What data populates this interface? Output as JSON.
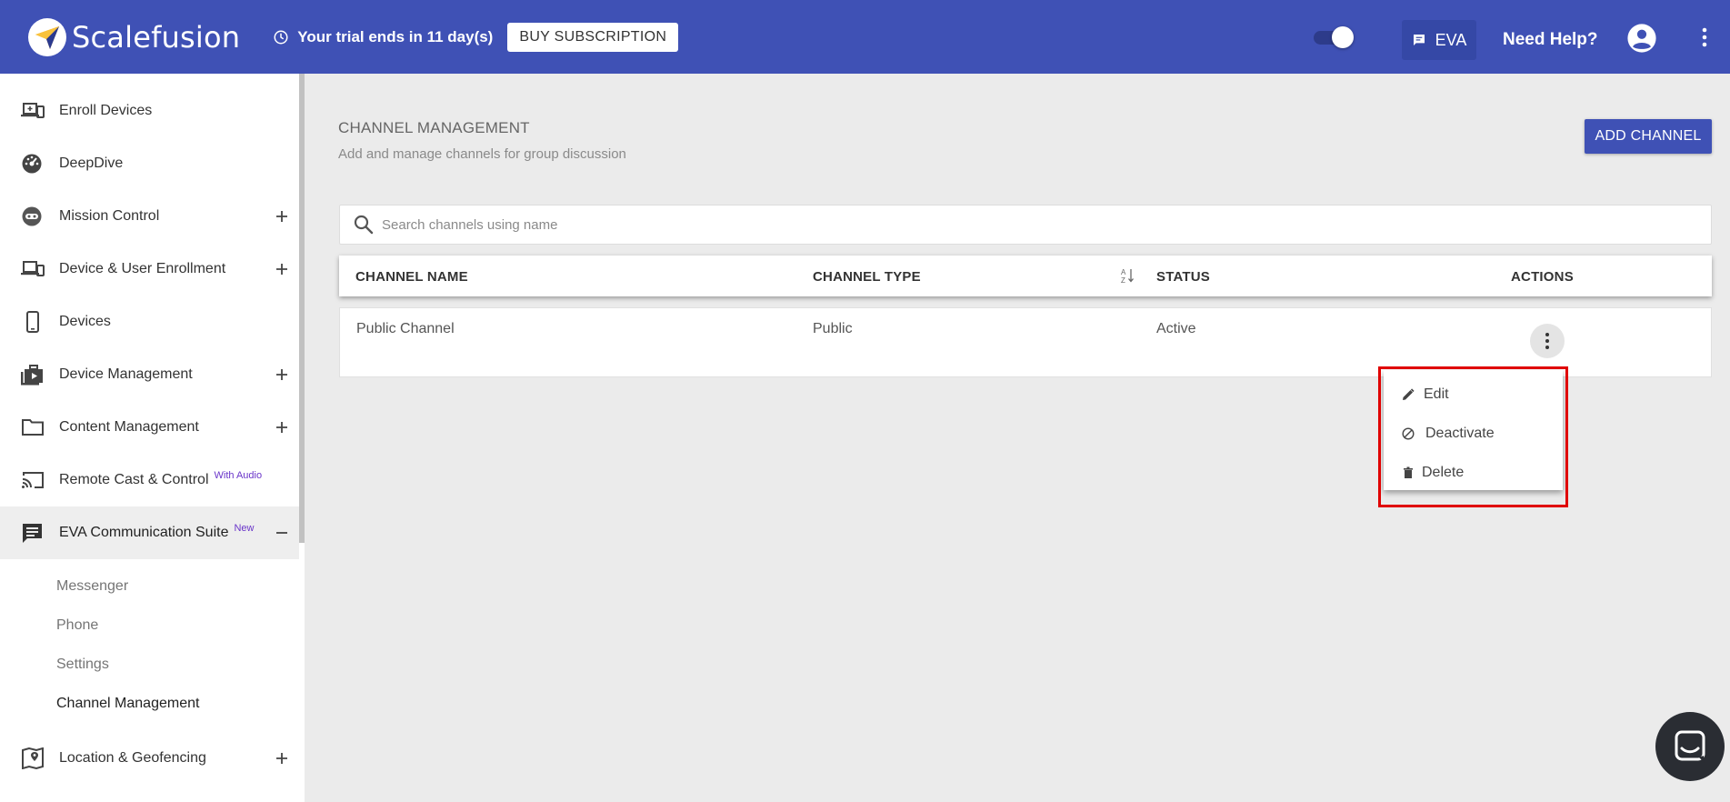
{
  "header": {
    "brand": "Scalefusion",
    "trial_text": "Your trial ends in 11 day(s)",
    "buy_label": "BUY SUBSCRIPTION",
    "eva_label": "EVA",
    "help_label": "Need Help?",
    "toggle_state": "on",
    "color": "#3f51b5"
  },
  "sidebar": {
    "items": [
      {
        "label": "Enroll Devices",
        "icon": "enroll-devices-icon"
      },
      {
        "label": "DeepDive",
        "icon": "dashboard-gauge-icon"
      },
      {
        "label": "Mission Control",
        "icon": "mission-control-icon",
        "expandable": true
      },
      {
        "label": "Device & User Enrollment",
        "icon": "devices-icon",
        "expandable": true
      },
      {
        "label": "Devices",
        "icon": "phone-icon"
      },
      {
        "label": "Device Management",
        "icon": "briefcase-icon",
        "expandable": true
      },
      {
        "label": "Content Management",
        "icon": "folder-icon",
        "expandable": true
      },
      {
        "label": "Remote Cast & Control",
        "icon": "cast-icon",
        "badge": "With Audio"
      },
      {
        "label": "EVA Communication Suite",
        "icon": "chat-icon",
        "badge": "New",
        "expanded": true
      },
      {
        "label": "Location & Geofencing",
        "icon": "map-location-icon",
        "expandable": true
      }
    ],
    "subitems": [
      "Messenger",
      "Phone",
      "Settings",
      "Channel Management"
    ],
    "selected_subitem": "Channel Management"
  },
  "main": {
    "title": "CHANNEL MANAGEMENT",
    "subtitle": "Add and manage channels for group discussion",
    "add_label": "ADD CHANNEL",
    "search_placeholder": "Search channels using name",
    "columns": [
      "CHANNEL NAME",
      "CHANNEL TYPE",
      "STATUS",
      "ACTIONS"
    ],
    "rows": [
      {
        "name": "Public Channel",
        "type": "Public",
        "status": "Active"
      }
    ]
  },
  "action_menu": {
    "items": [
      {
        "label": "Edit",
        "icon": "pencil-icon"
      },
      {
        "label": "Deactivate",
        "icon": "block-icon"
      },
      {
        "label": "Delete",
        "icon": "trash-icon"
      }
    ],
    "highlight_color": "#e00000"
  }
}
